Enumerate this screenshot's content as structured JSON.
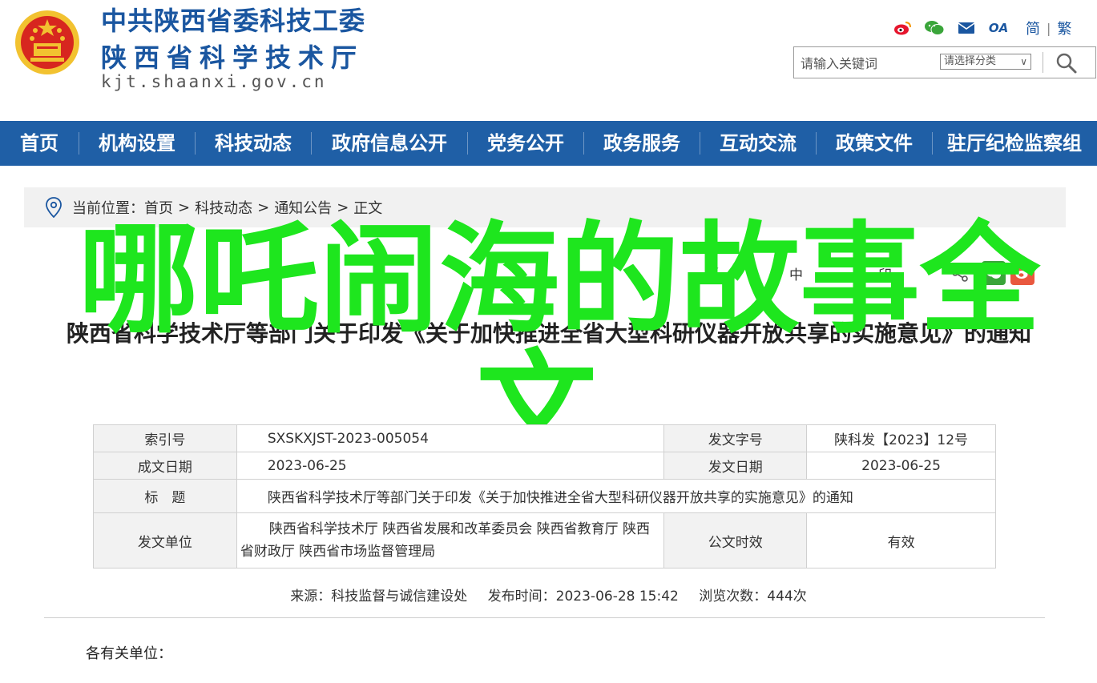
{
  "header": {
    "title_line1": "中共陕西省委科技工委",
    "title_line2": "陕西省科学技术厅",
    "domain": "kjt.shaanxi.gov.cn",
    "icons": [
      "weibo-icon",
      "wechat-icon",
      "mail-icon",
      "oa-icon"
    ],
    "oa_label": "OA",
    "lang_simplified": "简",
    "lang_separator": "|",
    "lang_traditional": "繁",
    "search_placeholder": "请输入关键词",
    "category_select": "请选择分类"
  },
  "nav": {
    "items": [
      "首页",
      "机构设置",
      "科技动态",
      "政府信息公开",
      "党务公开",
      "政务服务",
      "互动交流",
      "政策文件",
      "驻厅纪检监察组"
    ]
  },
  "breadcrumb": {
    "label": "当前位置：",
    "items": [
      "首页",
      "科技动态",
      "通知公告",
      "正文"
    ],
    "separator": ">"
  },
  "tools": {
    "font_size_open": "【",
    "font_size_label": "中",
    "print_label": "印"
  },
  "overlay_text": "哪吒闹海的故事全文,",
  "article": {
    "title": "陕西省科学技术厅等部门关于印发《关于加快推进全省大型科研仪器开放共享的实施意见》的通知"
  },
  "meta": {
    "index_label": "索引号",
    "index_value": "SXSKXJST-2023-005054",
    "doc_no_label": "发文字号",
    "doc_no_value": "陕科发【2023】12号",
    "created_label": "成文日期",
    "created_value": "2023-06-25",
    "issued_label": "发文日期",
    "issued_value": "2023-06-25",
    "subject_label": "标　题",
    "subject_value": "陕西省科学技术厅等部门关于印发《关于加快推进全省大型科研仪器开放共享的实施意见》的通知",
    "issuer_label": "发文单位",
    "issuer_value": "陕西省科学技术厅 陕西省发展和改革委员会 陕西省教育厅 陕西省财政厅 陕西省市场监督管理局",
    "validity_label": "公文时效",
    "validity_value": "有效"
  },
  "source_line": {
    "source": "来源：科技监督与诚信建设处",
    "published": "发布时间：2023-06-28 15:42",
    "views": "浏览次数：444次"
  },
  "body": {
    "greeting": "各有关单位："
  },
  "colors": {
    "brand_blue": "#1f5fa6",
    "overlay_green": "#1ee61e",
    "emblem_red": "#d7261f",
    "emblem_gold": "#f2c230"
  }
}
